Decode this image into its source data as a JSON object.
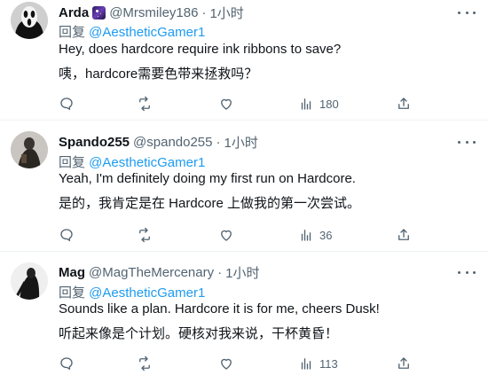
{
  "tweets": [
    {
      "name": "Arda",
      "handle": "@Mrsmiley186",
      "sep": "·",
      "time": "1小时",
      "reply_prefix": "回复 ",
      "reply_to": "@AestheticGamer1",
      "text_en": "Hey, does hardcore require ink ribbons to save?",
      "text_zh": "咦，hardcore需要色带来拯救吗？",
      "views": "180",
      "avatar": "ghostface mask"
    },
    {
      "name": "Spando255",
      "handle": "@spando255",
      "sep": "·",
      "time": "1小时",
      "reply_prefix": "回复 ",
      "reply_to": "@AestheticGamer1",
      "text_en": "Yeah, I'm definitely doing my first run on Hardcore.",
      "text_zh": "是的，我肯定是在 Hardcore 上做我的第一次尝试。",
      "views": "36",
      "avatar": "dark figure"
    },
    {
      "name": "Mag",
      "handle": "@MagTheMercenary",
      "sep": "·",
      "time": "1小时",
      "reply_prefix": "回复 ",
      "reply_to": "@AestheticGamer1",
      "text_en": "Sounds like a plan. Hardcore it is for me, cheers Dusk!",
      "text_zh": "听起来像是个计划。硬核对我来说，干杯黄昏！",
      "views": "113",
      "avatar": "dark silhouette"
    }
  ],
  "icons": {
    "reply": "comment-icon",
    "retweet": "retweet-icon",
    "like": "heart-icon",
    "views": "views-chart-icon",
    "share": "share-icon",
    "more": "more-icon"
  },
  "colors": {
    "text": "#0f1419",
    "secondary": "#536471",
    "link": "#1d9bf0",
    "divider": "#eff3f4"
  }
}
